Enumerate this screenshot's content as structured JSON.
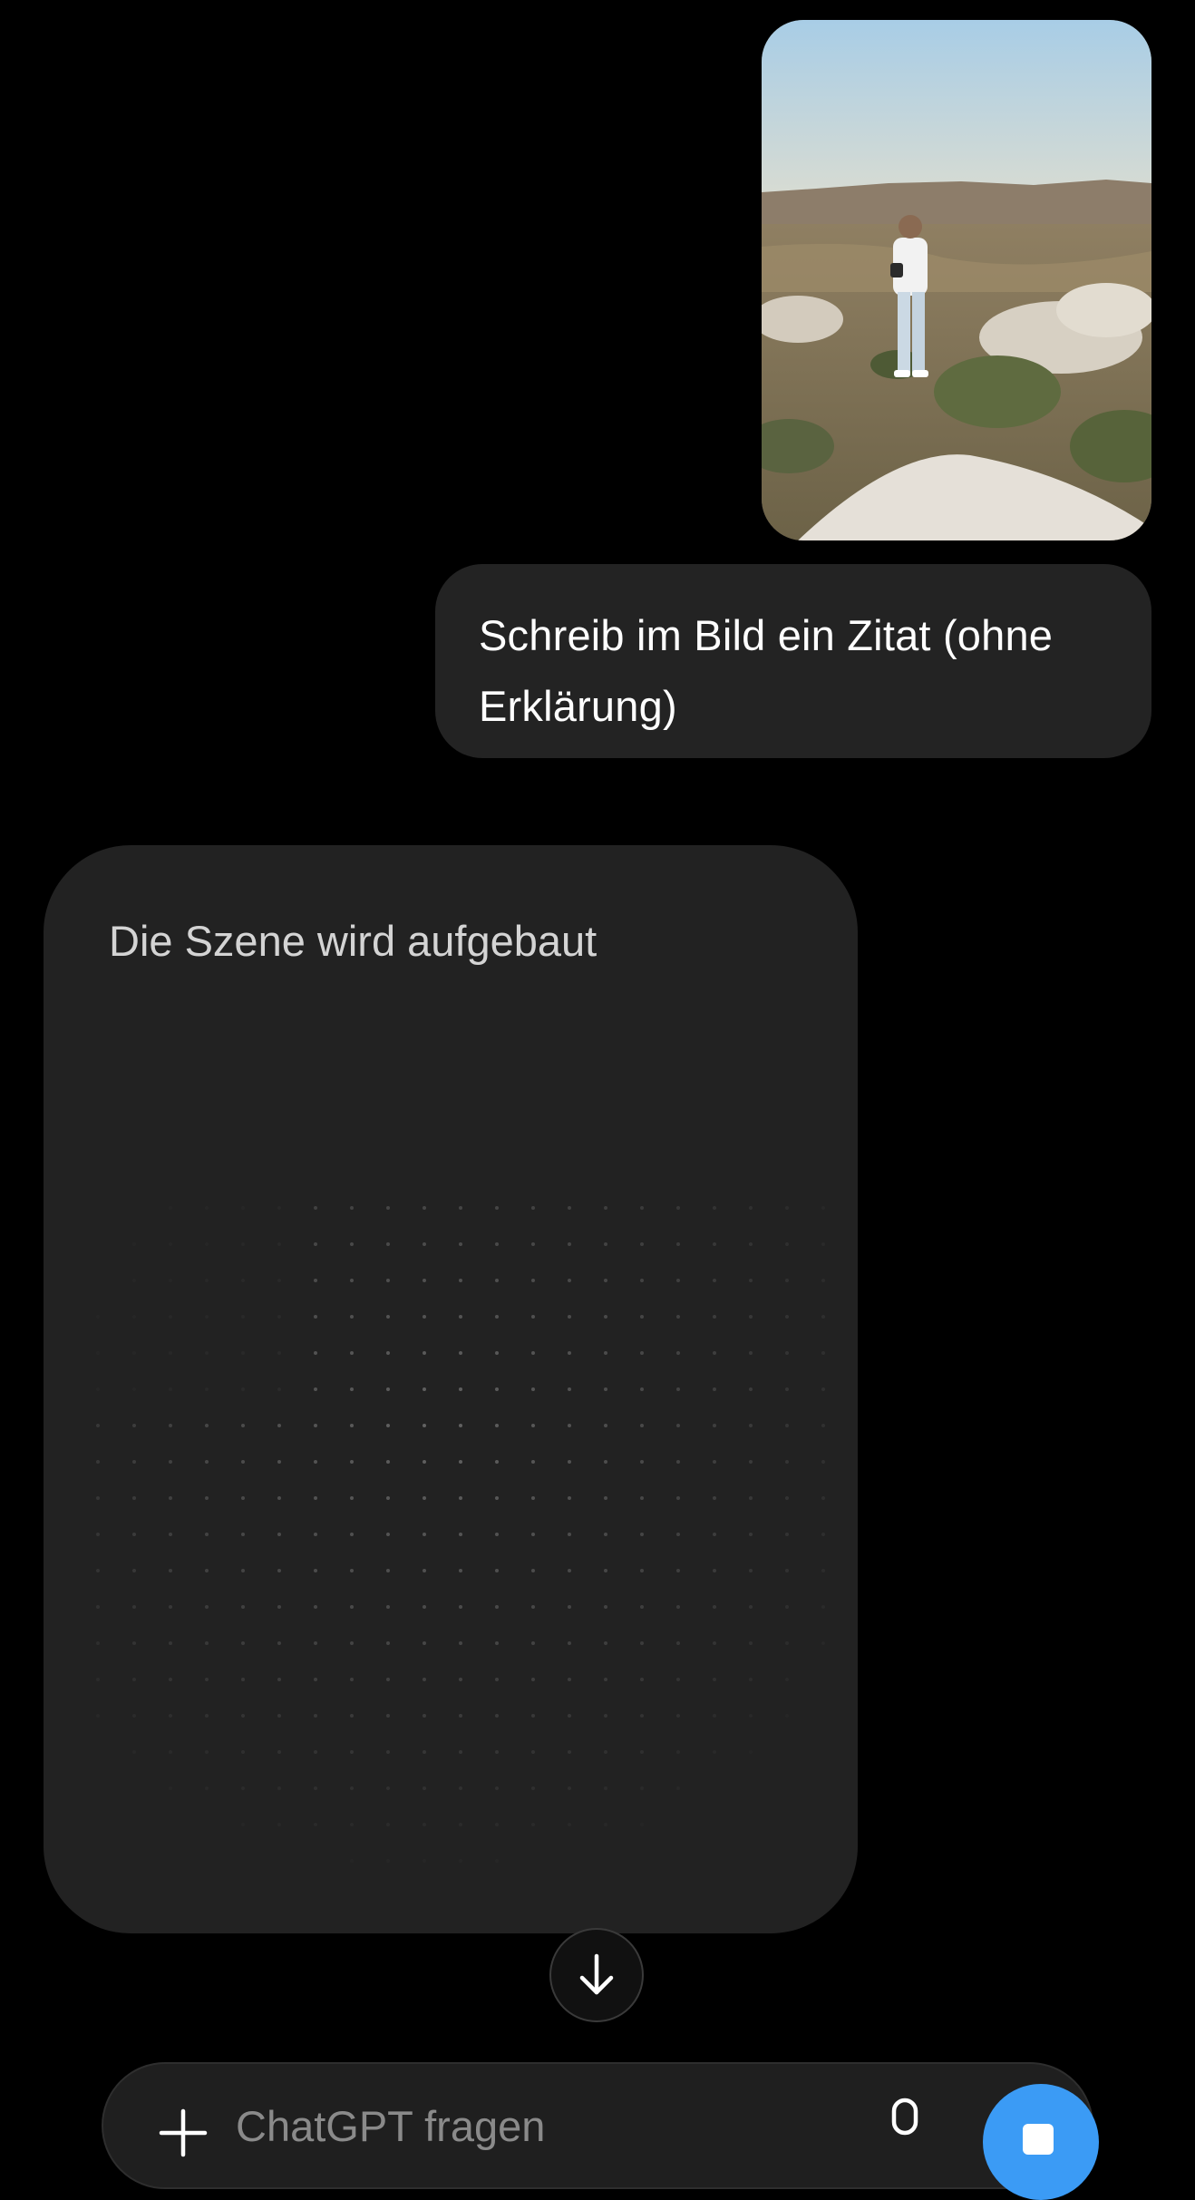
{
  "conversation": {
    "user_photo": {
      "icon": "photo-thumbnail"
    },
    "user_message": {
      "text": "Schreib im Bild ein Zitat (ohne Erklärung)"
    },
    "assistant": {
      "status_text": "Die Szene wird aufgebaut"
    }
  },
  "scroll_button": {
    "icon": "arrow-down-icon"
  },
  "composer": {
    "placeholder": "ChatGPT fragen",
    "value": "",
    "plus_icon": "plus-icon",
    "mic_icon": "microphone-icon",
    "stop_icon": "stop-icon"
  },
  "colors": {
    "background": "#000000",
    "bubble": "#232323",
    "card": "#222222",
    "accent": "#3b9bf5",
    "status_text": "#d4d4d4"
  }
}
